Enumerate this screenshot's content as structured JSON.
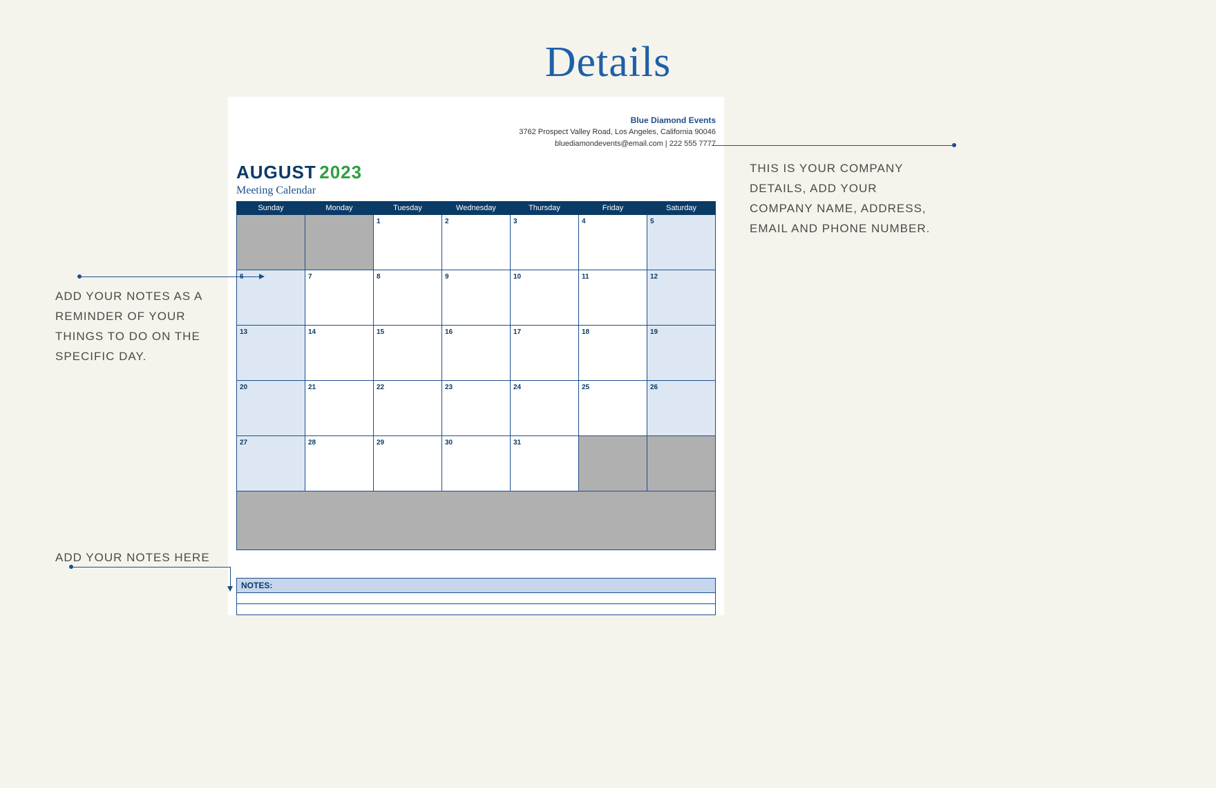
{
  "pageTitle": "Details",
  "company": {
    "name": "Blue Diamond Events",
    "address": "3762 Prospect Valley Road, Los Angeles, California 90046",
    "contact": "bluediamondevents@email.com | 222 555 7777"
  },
  "calendar": {
    "month": "AUGUST",
    "year": "2023",
    "subtitle": "Meeting Calendar",
    "days": [
      "Sunday",
      "Monday",
      "Tuesday",
      "Wednesday",
      "Thursday",
      "Friday",
      "Saturday"
    ],
    "weeks": [
      [
        {
          "n": "",
          "t": "blank"
        },
        {
          "n": "",
          "t": "blank"
        },
        {
          "n": "1",
          "t": "d"
        },
        {
          "n": "2",
          "t": "d"
        },
        {
          "n": "3",
          "t": "d"
        },
        {
          "n": "4",
          "t": "d"
        },
        {
          "n": "5",
          "t": "w"
        }
      ],
      [
        {
          "n": "6",
          "t": "w"
        },
        {
          "n": "7",
          "t": "d"
        },
        {
          "n": "8",
          "t": "d"
        },
        {
          "n": "9",
          "t": "d"
        },
        {
          "n": "10",
          "t": "d"
        },
        {
          "n": "11",
          "t": "d"
        },
        {
          "n": "12",
          "t": "w"
        }
      ],
      [
        {
          "n": "13",
          "t": "w"
        },
        {
          "n": "14",
          "t": "d"
        },
        {
          "n": "15",
          "t": "d"
        },
        {
          "n": "16",
          "t": "d"
        },
        {
          "n": "17",
          "t": "d"
        },
        {
          "n": "18",
          "t": "d"
        },
        {
          "n": "19",
          "t": "w"
        }
      ],
      [
        {
          "n": "20",
          "t": "w"
        },
        {
          "n": "21",
          "t": "d"
        },
        {
          "n": "22",
          "t": "d"
        },
        {
          "n": "23",
          "t": "d"
        },
        {
          "n": "24",
          "t": "d"
        },
        {
          "n": "25",
          "t": "d"
        },
        {
          "n": "26",
          "t": "w"
        }
      ],
      [
        {
          "n": "27",
          "t": "w"
        },
        {
          "n": "28",
          "t": "d"
        },
        {
          "n": "29",
          "t": "d"
        },
        {
          "n": "30",
          "t": "d"
        },
        {
          "n": "31",
          "t": "d"
        },
        {
          "n": "",
          "t": "blank"
        },
        {
          "n": "",
          "t": "blank"
        }
      ]
    ]
  },
  "notesLabel": "NOTES:",
  "annotations": {
    "right": "THIS IS YOUR COMPANY DETAILS, ADD YOUR COMPANY NAME, ADDRESS, EMAIL AND PHONE NUMBER.",
    "left": "ADD YOUR NOTES AS A REMINDER OF YOUR THINGS TO DO ON THE SPECIFIC DAY.",
    "notes": "ADD YOUR NOTES HERE"
  }
}
